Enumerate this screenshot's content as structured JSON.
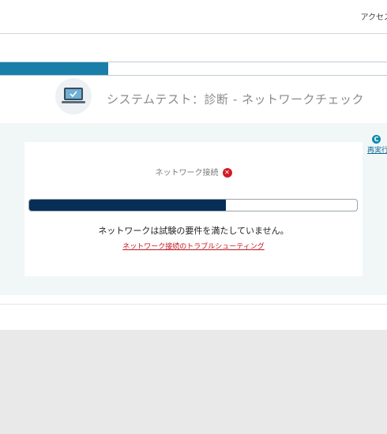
{
  "header": {
    "access_label": "アクセス"
  },
  "progress": {
    "value": 0.28
  },
  "page": {
    "title": "システムテスト：診断 - ネットワークチェック"
  },
  "rerun": {
    "label": "再実行"
  },
  "check": {
    "label": "ネットワーク接続",
    "status_icon": "error-icon",
    "bar_value": 0.6,
    "message": "ネットワークは試験の要件を満たしていません。",
    "link_label": "ネットワーク接続のトラブルシューティング"
  },
  "colors": {
    "accent": "#1a7fa8",
    "bar": "#062e57",
    "error": "#d11a26",
    "link": "#c4161c"
  }
}
